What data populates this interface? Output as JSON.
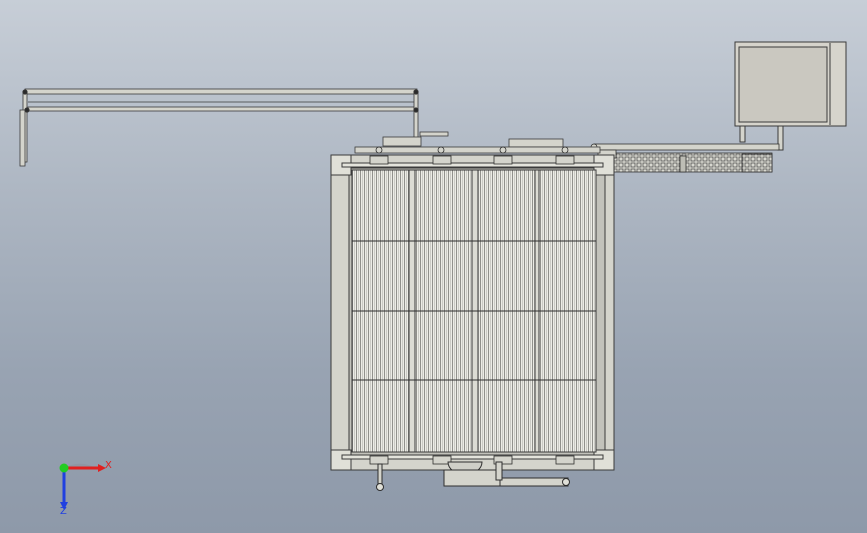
{
  "viewport": {
    "background_top": "#c7ced7",
    "background_bottom": "#8e99a9"
  },
  "model": {
    "name_icon": "machine-top-view",
    "line_color": "#3a3a3a",
    "body_color": "#d4d4cc",
    "panel_color": "#e6e6df"
  },
  "triad": {
    "x_label": "X",
    "z_label": "Z",
    "x_color": "#e02020",
    "y_color": "#22cc22",
    "z_color": "#2040e0"
  }
}
